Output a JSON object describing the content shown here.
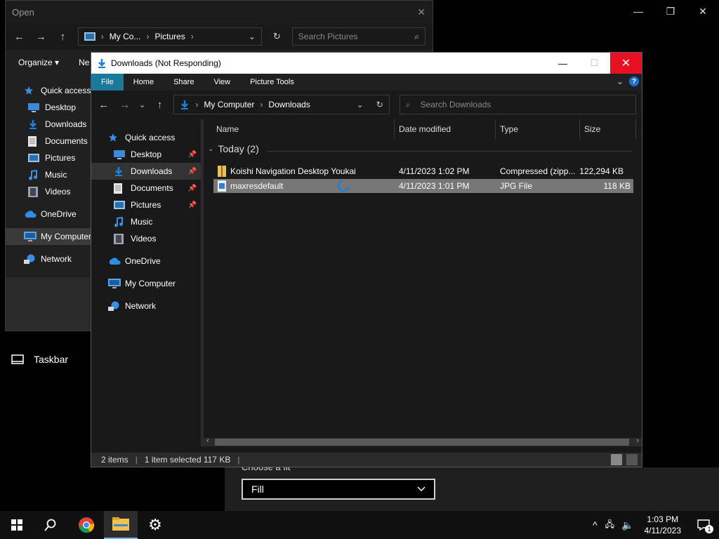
{
  "background": {
    "taskbar_setting": "Taskbar",
    "fit_caption": "Choose a fit",
    "fit_value": "Fill",
    "controls": {
      "minimize": "—",
      "restore": "❐",
      "close": "✕"
    }
  },
  "open_dialog": {
    "title": "Open",
    "close": "✕",
    "address": [
      "My Co...",
      "Pictures"
    ],
    "search_placeholder": "Search Pictures",
    "toolbar": {
      "organize": "Organize ▾",
      "new_folder": "Ne"
    },
    "nav": [
      {
        "label": "Quick access",
        "icon": "star-icon",
        "sub": false
      },
      {
        "label": "Desktop",
        "icon": "desktop-icon",
        "sub": true
      },
      {
        "label": "Downloads",
        "icon": "download-icon",
        "sub": true
      },
      {
        "label": "Documents",
        "icon": "document-icon",
        "sub": true
      },
      {
        "label": "Pictures",
        "icon": "pictures-icon",
        "sub": true
      },
      {
        "label": "Music",
        "icon": "music-icon",
        "sub": true
      },
      {
        "label": "Videos",
        "icon": "video-icon",
        "sub": true
      },
      {
        "label": "OneDrive",
        "icon": "cloud-icon",
        "sub": false
      },
      {
        "label": "My Computer",
        "icon": "computer-icon",
        "sub": false
      },
      {
        "label": "Network",
        "icon": "network-icon",
        "sub": false
      }
    ]
  },
  "explorer": {
    "title": "Downloads (Not Responding)",
    "ribbon_tabs": [
      "File",
      "Home",
      "Share",
      "View",
      "Picture Tools"
    ],
    "address": [
      "My Computer",
      "Downloads"
    ],
    "search_placeholder": "Search Downloads",
    "nav": [
      {
        "label": "Quick access",
        "icon": "star-icon",
        "sub": false,
        "pinned": false
      },
      {
        "label": "Desktop",
        "icon": "desktop-icon",
        "sub": true,
        "pinned": true
      },
      {
        "label": "Downloads",
        "icon": "download-icon",
        "sub": true,
        "pinned": true,
        "selected": true
      },
      {
        "label": "Documents",
        "icon": "document-icon",
        "sub": true,
        "pinned": true
      },
      {
        "label": "Pictures",
        "icon": "pictures-icon",
        "sub": true,
        "pinned": true
      },
      {
        "label": "Music",
        "icon": "music-icon",
        "sub": true,
        "pinned": false
      },
      {
        "label": "Videos",
        "icon": "video-icon",
        "sub": true,
        "pinned": false
      },
      {
        "label": "OneDrive",
        "icon": "cloud-icon",
        "sub": false,
        "pinned": false
      },
      {
        "label": "My Computer",
        "icon": "computer-icon",
        "sub": false,
        "pinned": false
      },
      {
        "label": "Network",
        "icon": "network-icon",
        "sub": false,
        "pinned": false
      }
    ],
    "columns": [
      "Name",
      "Date modified",
      "Type",
      "Size"
    ],
    "group": "Today (2)",
    "files": [
      {
        "name": "Koishi Navigation Desktop Youkai",
        "date": "4/11/2023 1:02 PM",
        "type": "Compressed (zipp...",
        "size": "122,294 KB",
        "icon": "zip-icon",
        "selected": false
      },
      {
        "name": "maxresdefault",
        "date": "4/11/2023 1:01 PM",
        "type": "JPG File",
        "size": "118 KB",
        "icon": "image-file-icon",
        "selected": true
      }
    ],
    "status": {
      "items": "2 items",
      "selected": "1 item selected  117 KB"
    }
  },
  "taskbar": {
    "time": "1:03 PM",
    "date": "4/11/2023",
    "notification_count": "1",
    "colors": {
      "accent": "#76b9ed",
      "close_red": "#e81123",
      "file_tab": "#1b7a9b"
    }
  }
}
